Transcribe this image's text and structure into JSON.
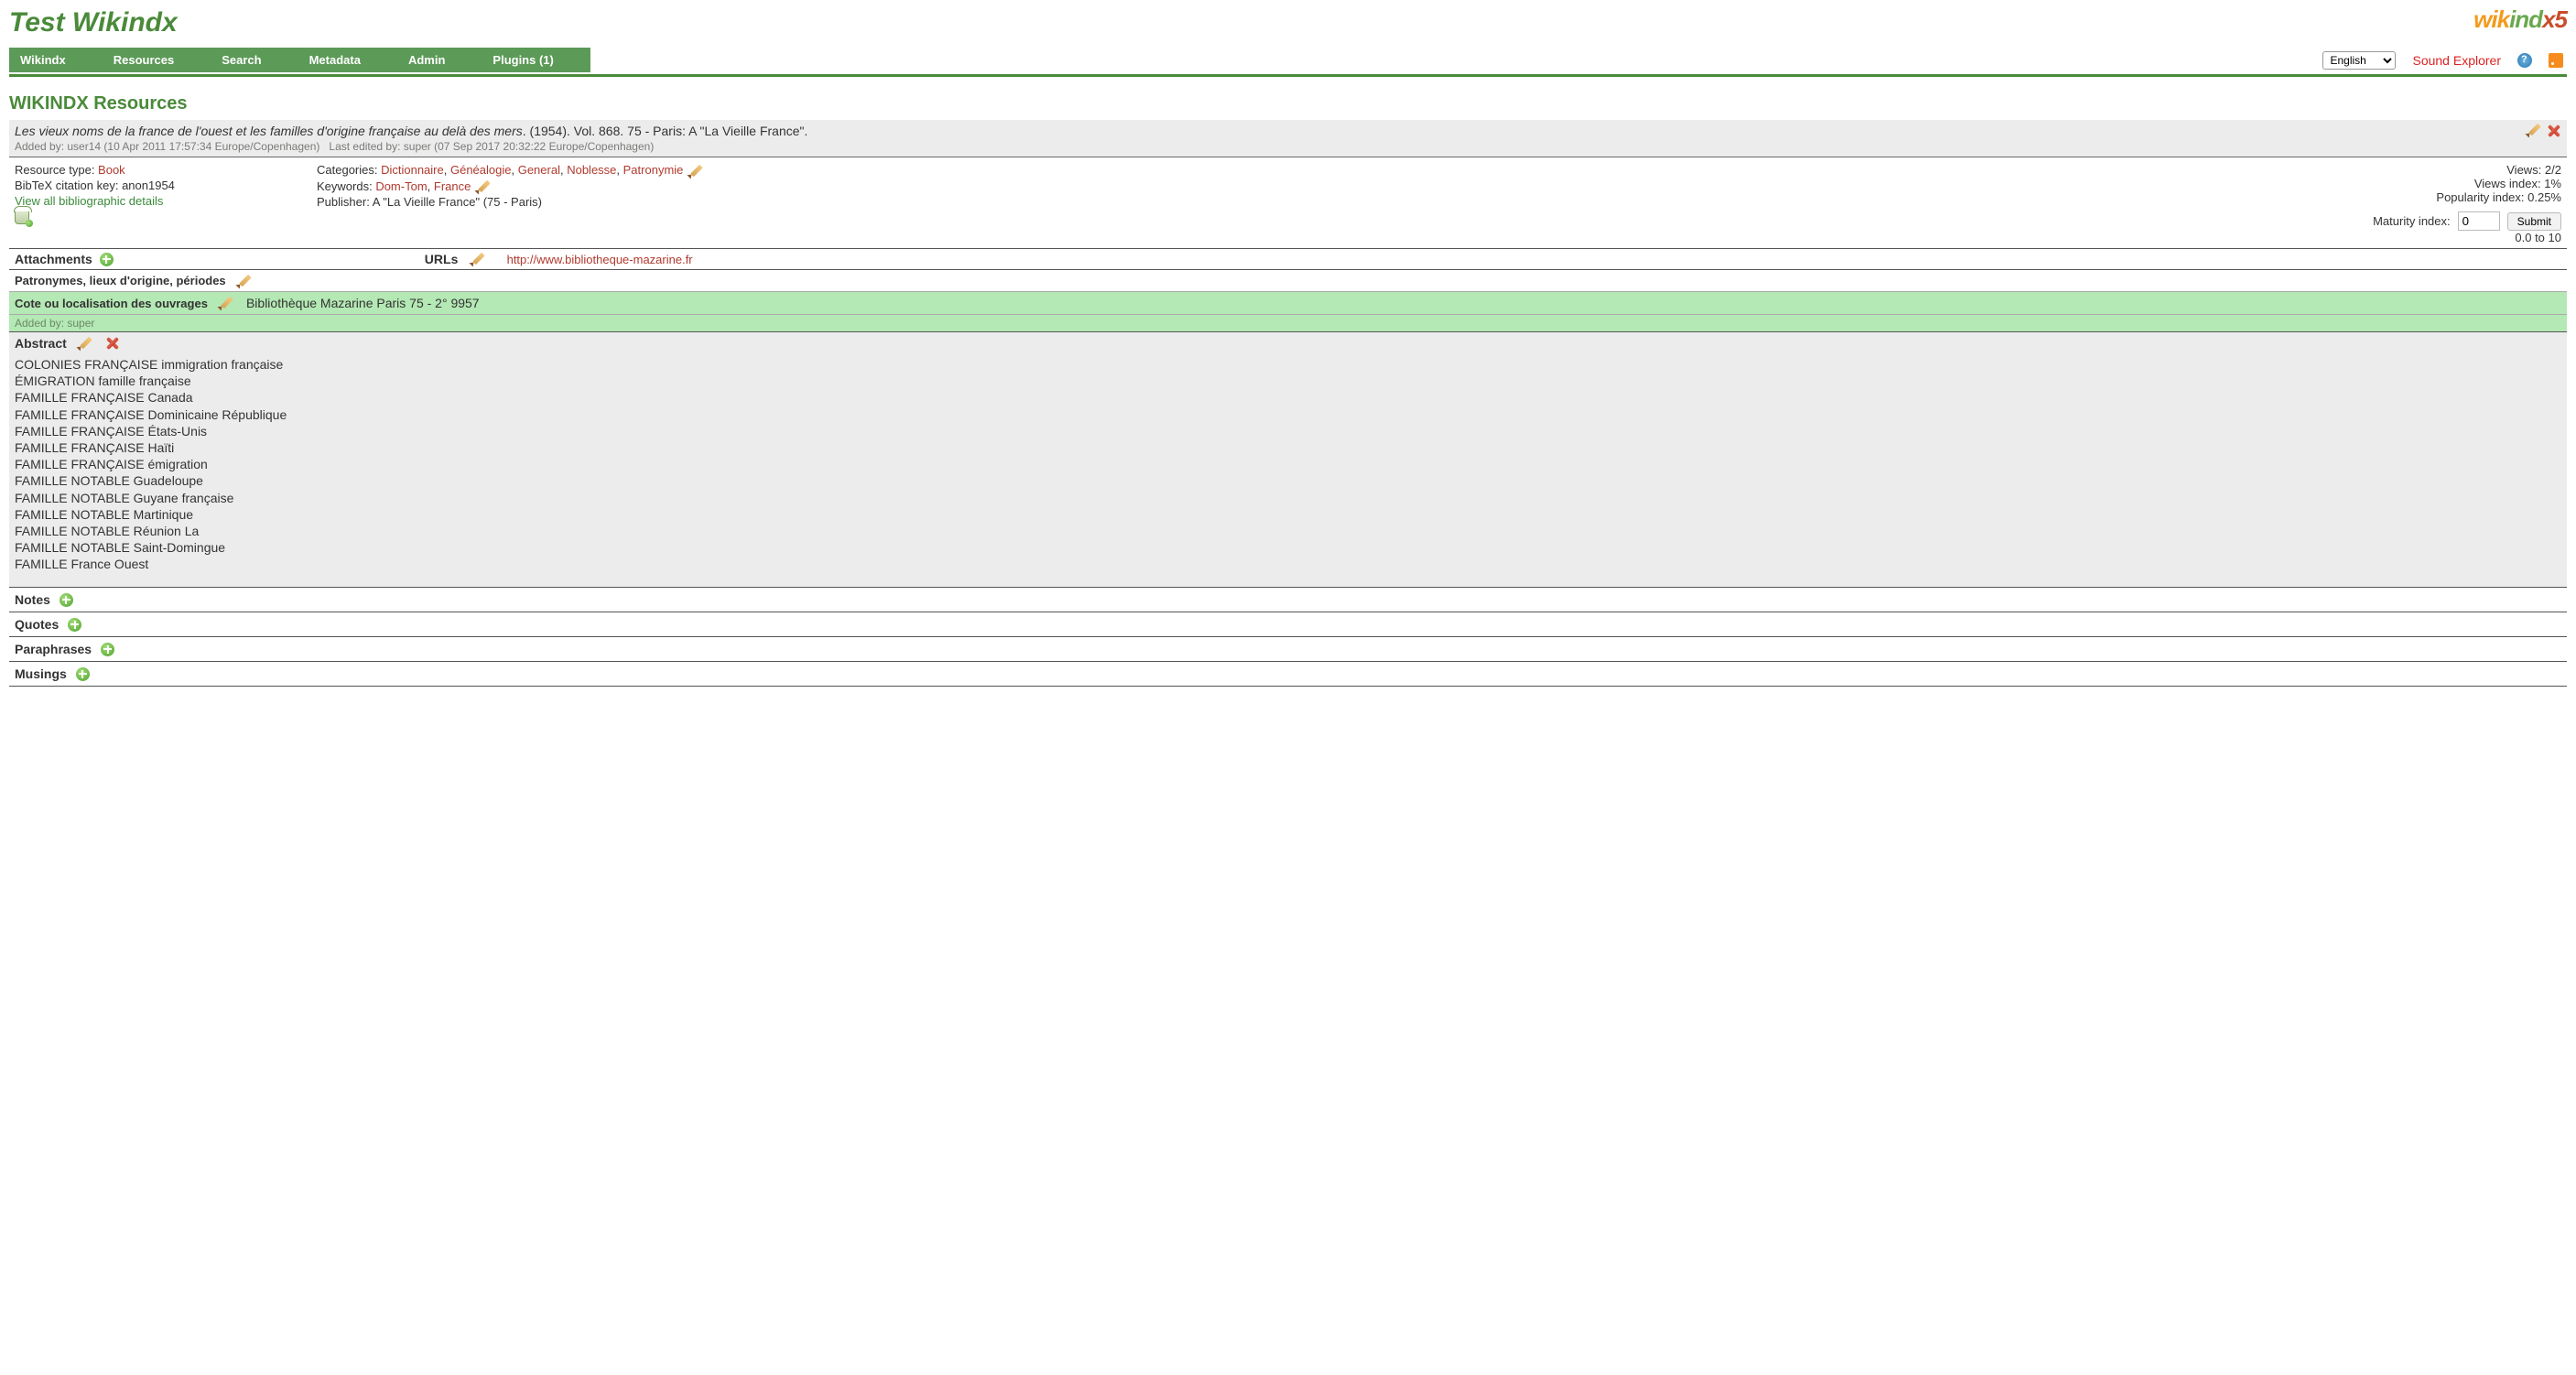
{
  "site_title": "Test Wikindx",
  "logo": {
    "part1": "wik",
    "part2": "ind",
    "part3": "x5"
  },
  "nav": {
    "items": [
      "Wikindx",
      "Resources",
      "Search",
      "Metadata",
      "Admin",
      "Plugins (1)"
    ],
    "language_value": "English",
    "sound_explorer": "Sound Explorer"
  },
  "page_title": "WIKINDX Resources",
  "citation": {
    "title_italic": "Les vieux noms de la france de l'ouest et les familles d'origine française au delà des mers",
    "rest": ". (1954). Vol. 868. 75 - Paris: A \"La Vieille France\".",
    "added_by": "Added by: user14 (10 Apr 2011 17:57:34 Europe/Copenhagen)",
    "edited_by": "Last edited by: super (07 Sep 2017 20:32:22 Europe/Copenhagen)"
  },
  "details": {
    "resource_type_label": "Resource type: ",
    "resource_type": "Book",
    "bibtex_label": "BibTeX citation key: ",
    "bibtex_key": "anon1954",
    "view_all": "View all bibliographic details",
    "categories_label": "Categories: ",
    "categories": [
      "Dictionnaire",
      "Généalogie",
      "General",
      "Noblesse",
      "Patronymie"
    ],
    "keywords_label": "Keywords: ",
    "keywords": [
      "Dom-Tom",
      "France"
    ],
    "publisher_label": "Publisher: ",
    "publisher": "A \"La Vieille France\" (75 - Paris)",
    "views": "Views: 2/2",
    "views_index": "Views index: 1%",
    "popularity_index": "Popularity index: 0.25%",
    "maturity_label": "Maturity index:",
    "maturity_value": "0",
    "submit": "Submit",
    "maturity_range": "0.0 to 10"
  },
  "attachments": {
    "label": "Attachments",
    "urls_label": "URLs",
    "url_text": "http://www.bibliotheque-mazarine.fr"
  },
  "custom": {
    "row1_label": "Patronymes, lieux d'origine, périodes",
    "row2_label": "Cote ou localisation des ouvrages",
    "row2_value": "Bibliothèque Mazarine Paris 75 - 2° 9957",
    "added_by": "Added by: super"
  },
  "abstract": {
    "label": "Abstract",
    "lines": [
      "COLONIES FRANÇAISE immigration française",
      "ÉMIGRATION famille française",
      "FAMILLE FRANÇAISE Canada",
      "FAMILLE FRANÇAISE Dominicaine République",
      "FAMILLE FRANÇAISE États-Unis",
      "FAMILLE FRANÇAISE Haïti",
      "FAMILLE FRANÇAISE émigration",
      "FAMILLE NOTABLE Guadeloupe",
      "FAMILLE NOTABLE Guyane française",
      "FAMILLE NOTABLE Martinique",
      "FAMILLE NOTABLE Réunion La",
      "FAMILLE NOTABLE Saint-Domingue",
      "FAMILLE France Ouest"
    ]
  },
  "sections": {
    "notes": "Notes",
    "quotes": "Quotes",
    "paraphrases": "Paraphrases",
    "musings": "Musings"
  }
}
